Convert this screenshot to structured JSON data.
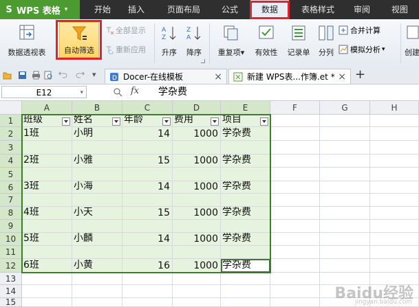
{
  "app": {
    "logo_glyph": "S",
    "title": "WPS 表格",
    "dropdown_glyph": "▾"
  },
  "menu": [
    {
      "label": "开始"
    },
    {
      "label": "插入"
    },
    {
      "label": "页面布局"
    },
    {
      "label": "公式"
    },
    {
      "label": "数据"
    },
    {
      "label": "表格样式"
    },
    {
      "label": "审阅"
    },
    {
      "label": "视图"
    }
  ],
  "ribbon": {
    "pivot": "数据透视表",
    "autofilter": "自动筛选",
    "show_all": "全部显示",
    "reapply": "重新应用",
    "sort_asc": "升序",
    "sort_desc": "降序",
    "duplicates": "重复项",
    "validity": "有效性",
    "record": "记录单",
    "split": "分列",
    "consolidate": "合并计算",
    "simulate": "模拟分析",
    "create": "创建",
    "dropdown_glyph": "▾"
  },
  "tabs": [
    {
      "label": "Docer-在线模板",
      "close": "×"
    },
    {
      "label": "新建 WPS表...作簿.et *",
      "close": "×"
    }
  ],
  "tabbar": {
    "add": "+",
    "nav_glyph": "▾"
  },
  "formula": {
    "cell_ref": "E12",
    "fx": "fx",
    "value": "学杂费",
    "zoom_glyph": "🔍"
  },
  "columns": [
    "A",
    "B",
    "C",
    "D",
    "E",
    "F",
    "G",
    "H"
  ],
  "rows": [
    "1",
    "2",
    "3",
    "4",
    "5",
    "6",
    "7",
    "8",
    "9",
    "10",
    "11",
    "12",
    "13",
    "14",
    "15"
  ],
  "headers": [
    "班级",
    "姓名",
    "年龄",
    "费用",
    "项目"
  ],
  "data": [
    {
      "row": 2,
      "cls": "1班",
      "name": "小明",
      "age": "14",
      "fee": "1000",
      "item": "学杂费"
    },
    {
      "row": 4,
      "cls": "2班",
      "name": "小雅",
      "age": "15",
      "fee": "1000",
      "item": "学杂费"
    },
    {
      "row": 6,
      "cls": "3班",
      "name": "小海",
      "age": "14",
      "fee": "1000",
      "item": "学杂费"
    },
    {
      "row": 8,
      "cls": "4班",
      "name": "小天",
      "age": "15",
      "fee": "1000",
      "item": "学杂费"
    },
    {
      "row": 10,
      "cls": "5班",
      "name": "小麟",
      "age": "14",
      "fee": "1000",
      "item": "学杂费"
    },
    {
      "row": 12,
      "cls": "6班",
      "name": "小黄",
      "age": "16",
      "fee": "1000",
      "item": "学杂费"
    }
  ],
  "watermark": {
    "main": "Baidu经验",
    "sub": "jingyan.baidu.com"
  },
  "colors": {
    "accent": "#4c9b31",
    "highlight_red": "#e0242b",
    "selection_green": "#e6f3de"
  }
}
